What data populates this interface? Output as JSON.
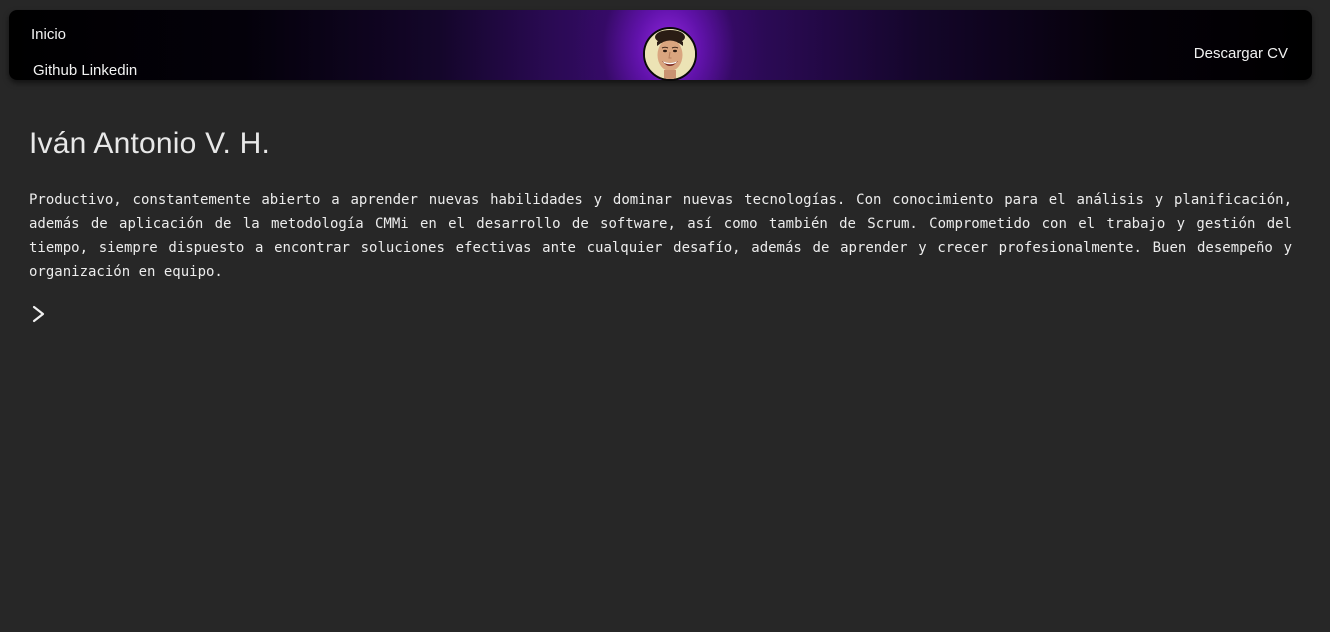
{
  "nav": {
    "home_label": "Inicio",
    "github_label": "Github",
    "linkedin_label": "Linkedin",
    "download_cv_label": "Descargar CV"
  },
  "profile": {
    "name": "Iván Antonio V. H.",
    "summary": "Productivo, constantemente abierto a aprender nuevas habilidades y dominar nuevas tecnologías. Con conocimiento para el análisis y planificación, además de aplicación de la metodología CMMi en el desarrollo de software, así como también de Scrum. Comprometido con el trabajo y gestión del tiempo, siempre dispuesto a encontrar soluciones efectivas ante cualquier desafío, además de aprender y crecer profesionalmente. Buen desempeño y organización en equipo."
  },
  "icons": {
    "avatar": "profile-photo",
    "expand": "chevron-right-icon"
  },
  "colors": {
    "background": "#272727",
    "accent": "#7a1fd6",
    "text": "#ececec"
  }
}
